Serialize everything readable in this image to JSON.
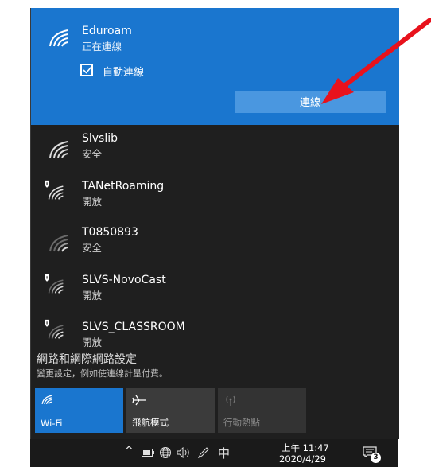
{
  "connected": {
    "name": "Eduroam",
    "status": "正在連線",
    "auto_connect_label": "自動連線",
    "auto_connect_checked": true,
    "connect_button": "連線"
  },
  "networks": [
    {
      "name": "Slvslib",
      "status": "安全",
      "secured": true
    },
    {
      "name": "TANetRoaming",
      "status": "開放",
      "secured": false
    },
    {
      "name": "T0850893",
      "status": "安全",
      "secured": true
    },
    {
      "name": "SLVS-NovoCast",
      "status": "開放",
      "secured": false
    },
    {
      "name": "SLVS_CLASSROOM",
      "status": "開放",
      "secured": false
    }
  ],
  "settings": {
    "title": "網路和網際網路設定",
    "subtitle": "變更設定，例如使連線計量付費。"
  },
  "quick_actions": [
    {
      "label": "Wi-Fi",
      "active": true,
      "icon": "wifi-icon"
    },
    {
      "label": "飛航模式",
      "active": false,
      "icon": "airplane-icon"
    },
    {
      "label": "行動熱點",
      "active": false,
      "icon": "hotspot-icon"
    }
  ],
  "taskbar": {
    "ime": "中",
    "time": "上午 11:47",
    "date": "2020/4/29",
    "notification_count": "3"
  },
  "colors": {
    "accent": "#1a76cf",
    "panel": "#1f1f1f",
    "annotation_arrow": "#e8121c"
  }
}
